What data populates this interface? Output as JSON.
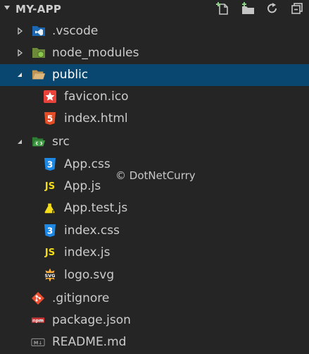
{
  "explorer": {
    "title": "MY-APP",
    "actions": [
      {
        "name": "new-file-icon"
      },
      {
        "name": "new-folder-icon"
      },
      {
        "name": "refresh-icon"
      },
      {
        "name": "collapse-all-icon"
      }
    ]
  },
  "tree": {
    "vscode": ".vscode",
    "node_modules": "node_modules",
    "public": "public",
    "favicon": "favicon.ico",
    "index_html": "index.html",
    "src": "src",
    "app_css": "App.css",
    "app_js": "App.js",
    "app_test_js": "App.test.js",
    "index_css": "index.css",
    "index_js": "index.js",
    "logo_svg": "logo.svg",
    "gitignore": ".gitignore",
    "package_json": "package.json",
    "readme": "README.md"
  },
  "icon_text": {
    "js": "JS",
    "svg": "SVG",
    "npm": "npm",
    "md": "M↓",
    "html": "5",
    "css": "3",
    "js_badge": "JS"
  },
  "watermark": "© DotNetCurry",
  "colors": {
    "background": "#252526",
    "selection": "#094771",
    "text": "#cccccc"
  }
}
